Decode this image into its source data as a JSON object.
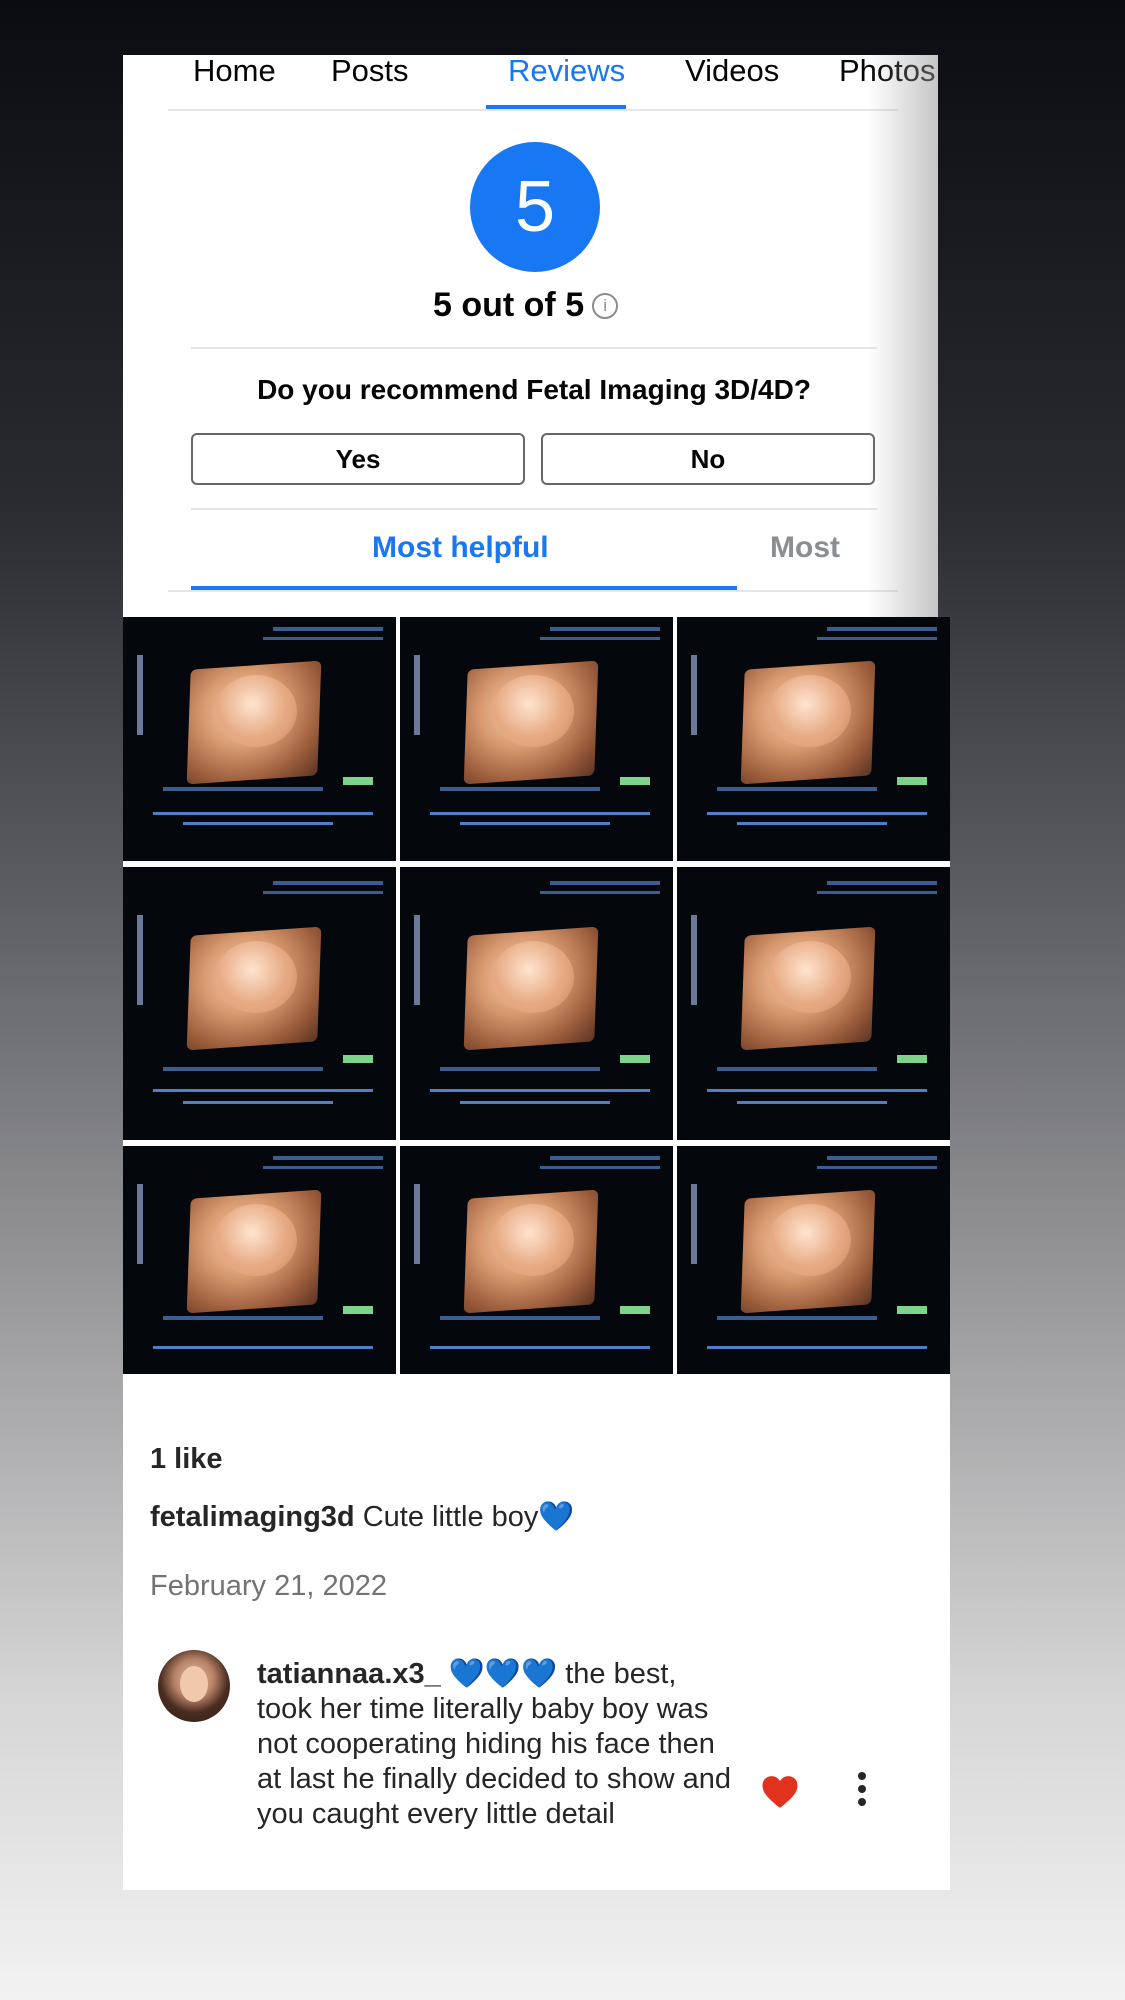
{
  "tabs": [
    {
      "label": "Home",
      "active": false
    },
    {
      "label": "Posts",
      "active": false
    },
    {
      "label": "Reviews",
      "active": true
    },
    {
      "label": "Videos",
      "active": false
    },
    {
      "label": "Photos",
      "active": false
    }
  ],
  "rating": {
    "value": "5",
    "text": "5 out of 5",
    "info_icon": "i"
  },
  "recommend": {
    "question": "Do you recommend Fetal Imaging 3D/4D?",
    "yes_label": "Yes",
    "no_label": "No"
  },
  "sort_tabs": {
    "most_helpful": "Most helpful",
    "most_recent": "Most"
  },
  "post": {
    "likes": "1 like",
    "caption_user": "fetalimaging3d",
    "caption_text": " Cute little boy💙",
    "date": "February 21, 2022",
    "comment": {
      "user": "tatiannaa.x3_",
      "text": " 💙💙💙 the best, took her time literally baby boy was not cooperating hiding his face then at last he finally decided to show and you caught every little detail",
      "liked": true
    }
  },
  "colors": {
    "accent": "#1877f2",
    "heart": "#e0321c"
  },
  "icons": [
    "info-icon",
    "heart-icon",
    "more-options-icon"
  ]
}
